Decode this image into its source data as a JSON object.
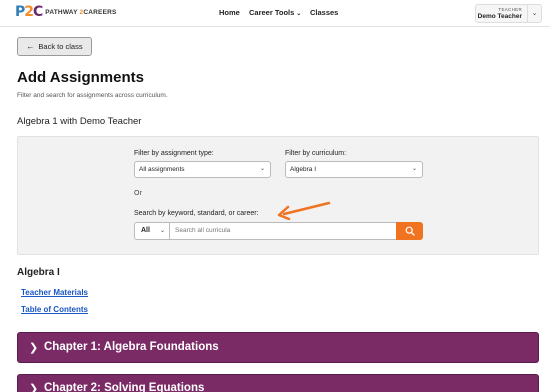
{
  "header": {
    "logo_mark": [
      "P",
      "2",
      "C"
    ],
    "logo_text_a": "PATHWAY ",
    "logo_text_b": "2",
    "logo_text_c": "CAREERS",
    "nav": {
      "home": "Home",
      "career_tools": "Career Tools",
      "classes": "Classes"
    },
    "user": {
      "role": "TEACHER",
      "name": "Demo Teacher"
    }
  },
  "back_button": "Back to class",
  "page": {
    "title": "Add Assignments",
    "subtitle": "Filter and search for assignments across curriculum.",
    "class_title": "Algebra 1 with Demo Teacher"
  },
  "filters": {
    "type_label": "Filter by assignment type:",
    "type_value": "All assignments",
    "curriculum_label": "Filter by curriculum:",
    "curriculum_value": "Algebra I",
    "or_text": "Or",
    "search_label": "Search by keyword, standard, or career:",
    "scope_value": "All",
    "search_placeholder": "Search all curricula"
  },
  "annotation_color": "#f07322",
  "curriculum": {
    "title": "Algebra I",
    "links": [
      "Teacher Materials",
      "Table of Contents"
    ],
    "chapters": [
      "Chapter 1: Algebra Foundations",
      "Chapter 2: Solving Equations"
    ]
  },
  "colors": {
    "accent": "#f07322",
    "chapter_bg": "#7a2b66",
    "link": "#1a56c4"
  }
}
